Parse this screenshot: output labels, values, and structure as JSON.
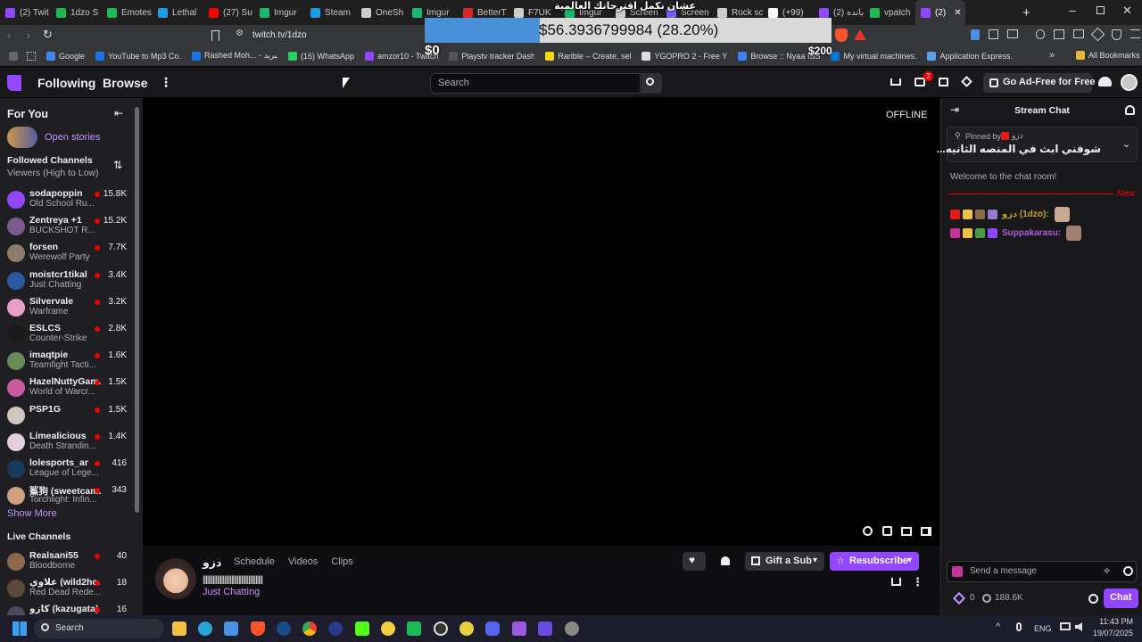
{
  "browser": {
    "tabs": [
      {
        "label": "(2) Twit",
        "color": "#9146ff"
      },
      {
        "label": "1dzo S",
        "color": "#1db954"
      },
      {
        "label": "Emotes",
        "color": "#1db954"
      },
      {
        "label": "Lethal",
        "color": "#1b9be0"
      },
      {
        "label": "(27) Su",
        "color": "#ff0000"
      },
      {
        "label": "Imgur",
        "color": "#1bb76e"
      },
      {
        "label": "Steam",
        "color": "#1b9be0"
      },
      {
        "label": "OneSh",
        "color": "#cccccc"
      },
      {
        "label": "Imgur",
        "color": "#1bb76e"
      },
      {
        "label": "BetterT",
        "color": "#d9262b"
      },
      {
        "label": "F7UK",
        "color": "#cccccc"
      },
      {
        "label": "Imgur",
        "color": "#1bb76e"
      },
      {
        "label": "Screen",
        "color": "#cccccc"
      },
      {
        "label": "Screen",
        "color": "#7b5cff"
      },
      {
        "label": "Rock sc",
        "color": "#cccccc"
      },
      {
        "label": "(+99)",
        "color": "#ffffff"
      },
      {
        "label": "(2) بانده",
        "color": "#9146ff"
      },
      {
        "label": "vpatch",
        "color": "#1db954"
      },
      {
        "label": "(2)",
        "color": "#9146ff"
      }
    ],
    "url": "twitch.tv/1dzo",
    "bookmarks": [
      {
        "label": "Google",
        "color": "#4285f4"
      },
      {
        "label": "YouTube to Mp3 Co...",
        "color": "#1a73e8"
      },
      {
        "label": "Rashed Moh... - البريد",
        "color": "#1a73e8"
      },
      {
        "label": "(16) WhatsApp",
        "color": "#25d366"
      },
      {
        "label": "amzor10 - Twitch",
        "color": "#9146ff"
      },
      {
        "label": "Playstv tracker Dash...",
        "color": "#555555"
      },
      {
        "label": "Rarible – Create, sell...",
        "color": "#feda03"
      },
      {
        "label": "YGOPRO 2 - Free Yu...",
        "color": "#dddddd"
      },
      {
        "label": "Browse :: Nyaa ISS",
        "color": "#3b82f6"
      },
      {
        "label": "My virtual machines...",
        "color": "#0078d4"
      },
      {
        "label": "Application Express...",
        "color": "#5aa0e6"
      }
    ],
    "all_bookmarks": "All Bookmarks"
  },
  "overlay": {
    "title": "عشان نكمل اقترحاتك العالمية",
    "amount": "$56.3936799984 (28.20%)",
    "progress_percent": 28.2,
    "min": "$0",
    "max": "$200"
  },
  "nav": {
    "following": "Following",
    "browse": "Browse",
    "search_placeholder": "Search",
    "notif_count": "2",
    "ad_free": "Go Ad-Free for Free"
  },
  "sidebar": {
    "for_you": "For You",
    "open_stories": "Open stories",
    "followed_title": "Followed Channels",
    "followed_sort": "Viewers (High to Low)",
    "followed": [
      {
        "name": "sodapoppin",
        "game": "Old School Ru...",
        "viewers": "15.8K",
        "color": "#9146ff"
      },
      {
        "name": "Zentreya +1",
        "game": "BUCKSHOT R...",
        "viewers": "15.2K",
        "color": "#7a5a8a"
      },
      {
        "name": "forsen",
        "game": "Werewolf Party",
        "viewers": "7.7K",
        "color": "#8c7a6a"
      },
      {
        "name": "moistcr1tikal",
        "game": "Just Chatting",
        "viewers": "3.4K",
        "color": "#2c5aa0"
      },
      {
        "name": "Silvervale",
        "game": "Warframe",
        "viewers": "3.2K",
        "color": "#e8a0c8"
      },
      {
        "name": "ESLCS",
        "game": "Counter-Strike",
        "viewers": "2.8K",
        "color": "#1a1a1a"
      },
      {
        "name": "imaqtpie",
        "game": "Teamfight Tacti...",
        "viewers": "1.6K",
        "color": "#6a8a5a"
      },
      {
        "name": "HazelNuttyGam...",
        "game": "World of Warcr...",
        "viewers": "1.5K",
        "color": "#c85aa0"
      },
      {
        "name": "PSP1G",
        "game": "",
        "viewers": "1.5K",
        "color": "#d0c8c0"
      },
      {
        "name": "Limealicious",
        "game": "Death Strandin...",
        "viewers": "1.4K",
        "color": "#e0d0e0"
      },
      {
        "name": "lolesports_ar",
        "game": "League of Lege...",
        "viewers": "416",
        "color": "#1a3a5a"
      },
      {
        "name": "鯊狗 (sweetcam...",
        "game": "Torchlight: Infin...",
        "viewers": "343",
        "color": "#d0a080"
      }
    ],
    "show_more": "Show More",
    "live_title": "Live Channels",
    "live": [
      {
        "name": "Realsani55",
        "game": "Bloodborne",
        "viewers": "40",
        "color": "#8a6a4a"
      },
      {
        "name": "علاوي (wild2ho...",
        "game": "Red Dead Rede...",
        "viewers": "18",
        "color": "#5a4a3a"
      },
      {
        "name": "كازو (kazugata)",
        "game": "",
        "viewers": "16",
        "color": "#4a4a5a"
      }
    ]
  },
  "player": {
    "offline": "OFFLINE"
  },
  "channel": {
    "name": "دزو",
    "tabs": [
      "Schedule",
      "Videos",
      "Clips"
    ],
    "title": "||||||||||||||||||||||||||||||||||||||||||",
    "category": "Just Chatting",
    "gift": "Gift a Sub",
    "resubscribe": "Resubscribe"
  },
  "chat": {
    "title": "Stream Chat",
    "pinned_by": "Pinned by",
    "pinned_user": "دزو",
    "pinned_msg": "شوفني ابث في المنصه الثانيه...",
    "welcome": "Welcome to the chat room!",
    "new_label": "New",
    "messages": [
      {
        "user": "دزو (1dzo):",
        "color": "#c9a227"
      },
      {
        "user": "Suppakarasu:",
        "color": "#b05ad8"
      }
    ],
    "input_placeholder": "Send a message",
    "points": "0",
    "viewers": "188.6K",
    "chat_button": "Chat"
  },
  "taskbar": {
    "search": "Search",
    "lang": "ENG",
    "time": "11:43 PM",
    "date": "19/07/2025"
  }
}
